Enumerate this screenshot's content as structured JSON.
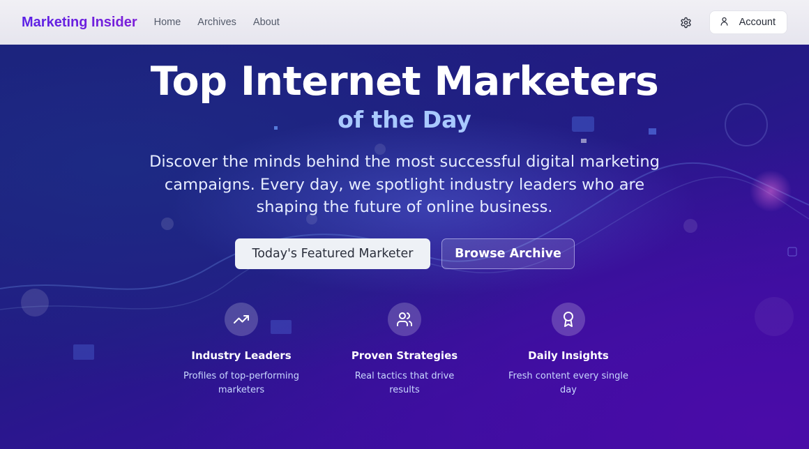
{
  "header": {
    "brand": "Marketing Insider",
    "nav": [
      "Home",
      "Archives",
      "About"
    ],
    "account_label": "Account"
  },
  "hero": {
    "title": "Top Internet Marketers",
    "subtitle": "of the Day",
    "description": "Discover the minds behind the most successful digital marketing campaigns. Every day, we spotlight industry leaders who are shaping the future of online business.",
    "primary_button": "Today's Featured Marketer",
    "secondary_button": "Browse Archive"
  },
  "features": [
    {
      "icon": "trending-up-icon",
      "title": "Industry Leaders",
      "description": "Profiles of top-performing marketers"
    },
    {
      "icon": "users-icon",
      "title": "Proven Strategies",
      "description": "Real tactics that drive results"
    },
    {
      "icon": "award-icon",
      "title": "Daily Insights",
      "description": "Fresh content every single day"
    }
  ],
  "colors": {
    "brand_gradient_start": "#5b21e6",
    "brand_gradient_end": "#7c1fd8",
    "hero_background": "#241a86",
    "subtitle": "#a9c9ff"
  }
}
